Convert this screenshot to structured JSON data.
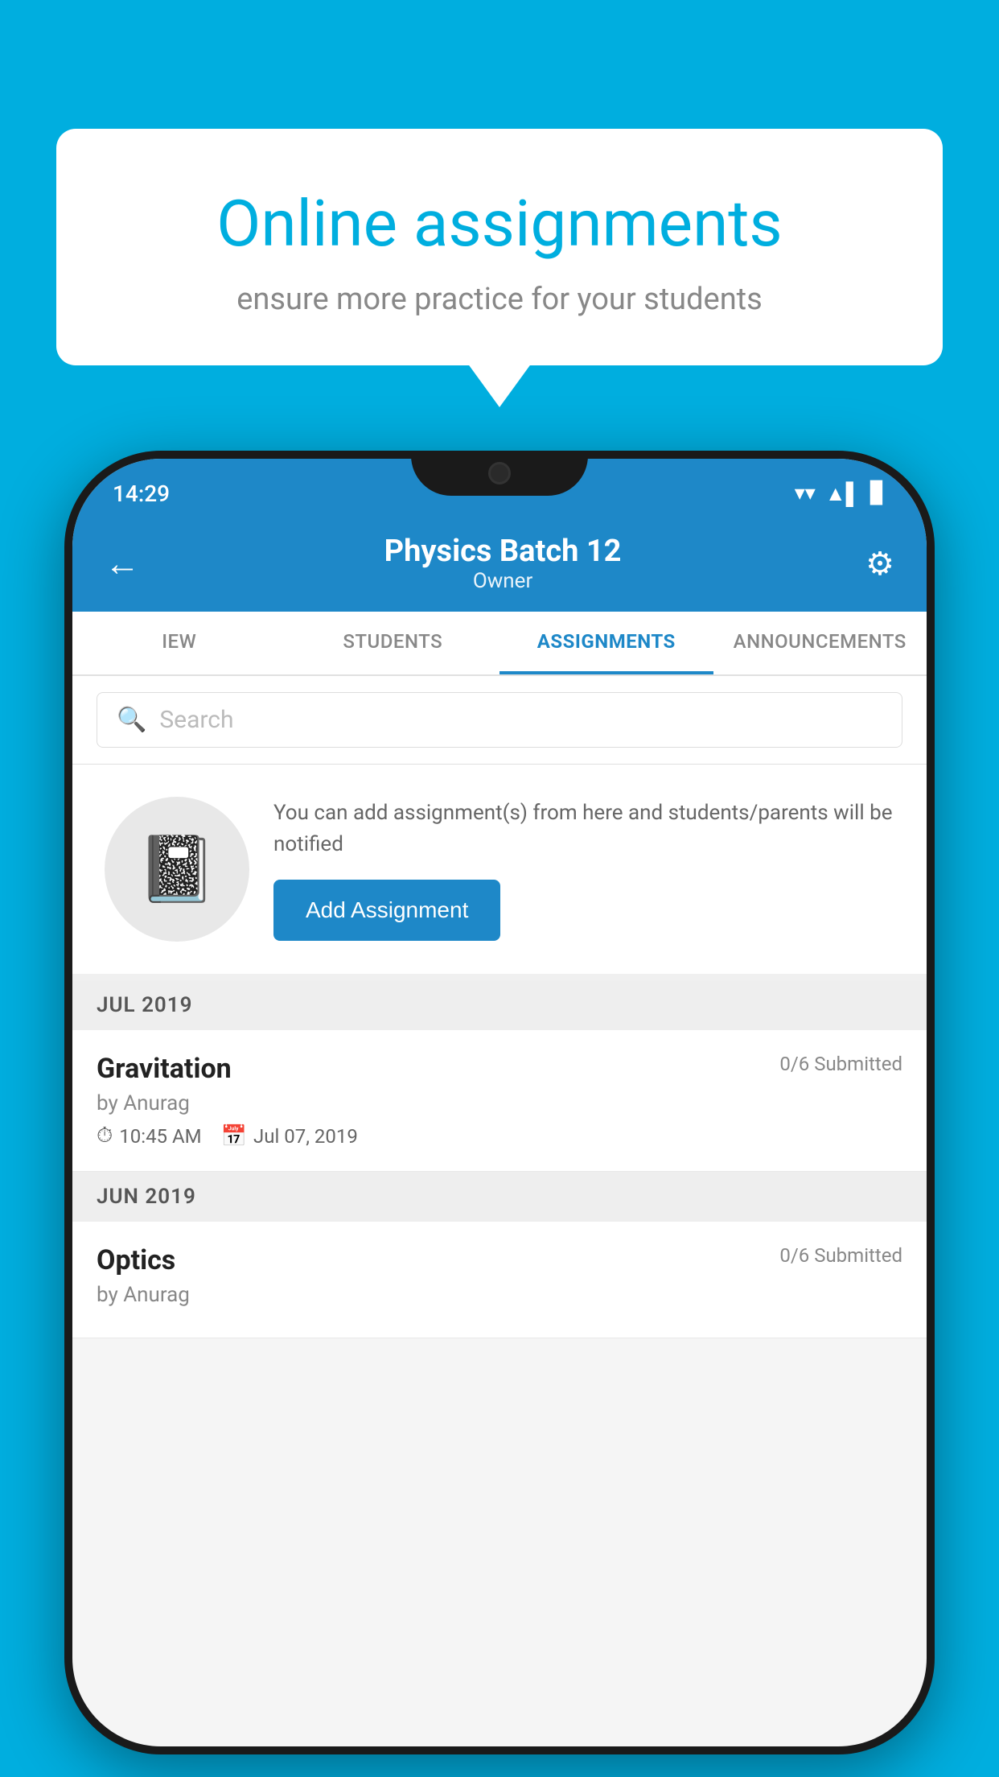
{
  "background": {
    "color": "#00AEDF"
  },
  "speech_bubble": {
    "title": "Online assignments",
    "subtitle": "ensure more practice for your students"
  },
  "status_bar": {
    "time": "14:29",
    "wifi": "▼",
    "signal": "▲",
    "battery": "▌"
  },
  "header": {
    "title": "Physics Batch 12",
    "subtitle": "Owner",
    "back_label": "←",
    "settings_label": "⚙"
  },
  "tabs": [
    {
      "label": "IEW",
      "active": false
    },
    {
      "label": "STUDENTS",
      "active": false
    },
    {
      "label": "ASSIGNMENTS",
      "active": true
    },
    {
      "label": "ANNOUNCEMENTS",
      "active": false
    }
  ],
  "search": {
    "placeholder": "Search"
  },
  "promo": {
    "description": "You can add assignment(s) from here and students/parents will be notified",
    "button_label": "Add Assignment"
  },
  "sections": [
    {
      "label": "JUL 2019",
      "assignments": [
        {
          "title": "Gravitation",
          "submitted": "0/6 Submitted",
          "by": "by Anurag",
          "time": "10:45 AM",
          "date": "Jul 07, 2019"
        }
      ]
    },
    {
      "label": "JUN 2019",
      "assignments": [
        {
          "title": "Optics",
          "submitted": "0/6 Submitted",
          "by": "by Anurag",
          "time": "",
          "date": ""
        }
      ]
    }
  ]
}
